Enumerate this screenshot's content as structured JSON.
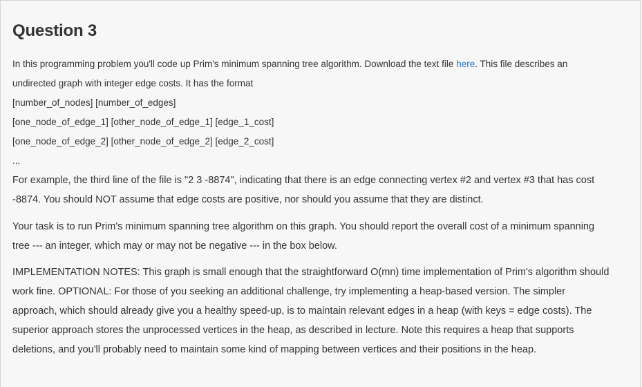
{
  "question": {
    "title": "Question 3"
  },
  "intro": {
    "before_link": "In this programming problem you'll code up Prim's minimum spanning tree algorithm. Download the text file ",
    "link_text": "here",
    "after_link": ". This file describes an",
    "line2": "undirected graph with integer edge costs. It has the format"
  },
  "format_lines": [
    "[number_of_nodes] [number_of_edges]",
    "[one_node_of_edge_1] [other_node_of_edge_1] [edge_1_cost]",
    "[one_node_of_edge_2] [other_node_of_edge_2] [edge_2_cost]",
    "..."
  ],
  "example": {
    "line1": "For example, the third line of the file is \"2 3 -8874\", indicating that there is an edge connecting vertex #2 and vertex #3 that has cost",
    "line2": "-8874. You should NOT assume that edge costs are positive, nor should you assume that they are distinct."
  },
  "task": {
    "line1": "Your task is to run Prim's minimum spanning tree algorithm on this graph. You should report the overall cost of a minimum spanning",
    "line2": "tree --- an integer, which may or may not be negative --- in the box below."
  },
  "notes": {
    "line1": "IMPLEMENTATION NOTES: This graph is small enough that the straightforward O(mn) time implementation of Prim's algorithm should",
    "line2": "work fine. OPTIONAL: For those of you seeking an additional challenge, try implementing a heap-based version. The simpler",
    "line3": "approach, which should already give you a healthy speed-up, is to maintain relevant edges in a heap (with keys = edge costs). The",
    "line4": "superior approach stores the unprocessed vertices in the heap, as described in lecture. Note this requires a heap that supports",
    "line5": "deletions, and you'll probably need to maintain some kind of mapping between vertices and their positions in the heap."
  },
  "colors": {
    "background": "#f7f7f7",
    "text": "#333333",
    "link": "#2a73cc"
  }
}
